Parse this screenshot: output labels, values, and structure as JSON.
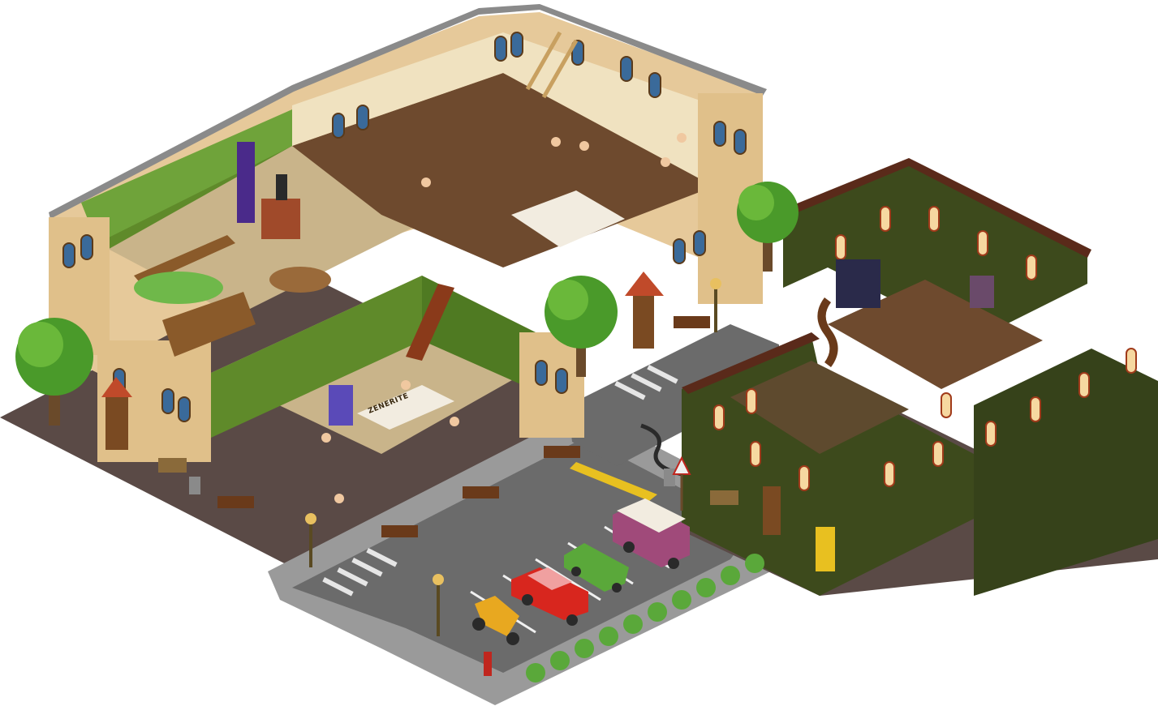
{
  "scene": {
    "type": "isometric-room-builder",
    "buildings": [
      "left-mansion",
      "right-green-hall"
    ],
    "signs": {
      "reception_sign": "ZENERITE"
    },
    "colors": {
      "background": "#ffffff",
      "asphalt": "#6b6b6b",
      "sidewalk": "#9a9a9a",
      "cobble": "#5a4a46",
      "beige_wall": "#e6c99a",
      "green_wall": "#5f8a2a",
      "dark_green_wall": "#3d4a1c",
      "wood_floor": "#6e4a2e",
      "checker_floor": "#c9b48a",
      "tree_green": "#4a9a2a",
      "red_car": "#d8261e",
      "van_purple": "#a04a7a",
      "taxi_yellow": "#e8a820",
      "hydrant_red": "#c0261e"
    },
    "vehicles": [
      "red-car",
      "purple-van",
      "green-race-car",
      "yellow-motorcycle"
    ],
    "icons": [
      "tree-icon",
      "lamp-post-icon",
      "bench-icon",
      "trash-can-icon",
      "warning-sign-icon",
      "hydrant-icon",
      "vending-machine-icon"
    ]
  }
}
